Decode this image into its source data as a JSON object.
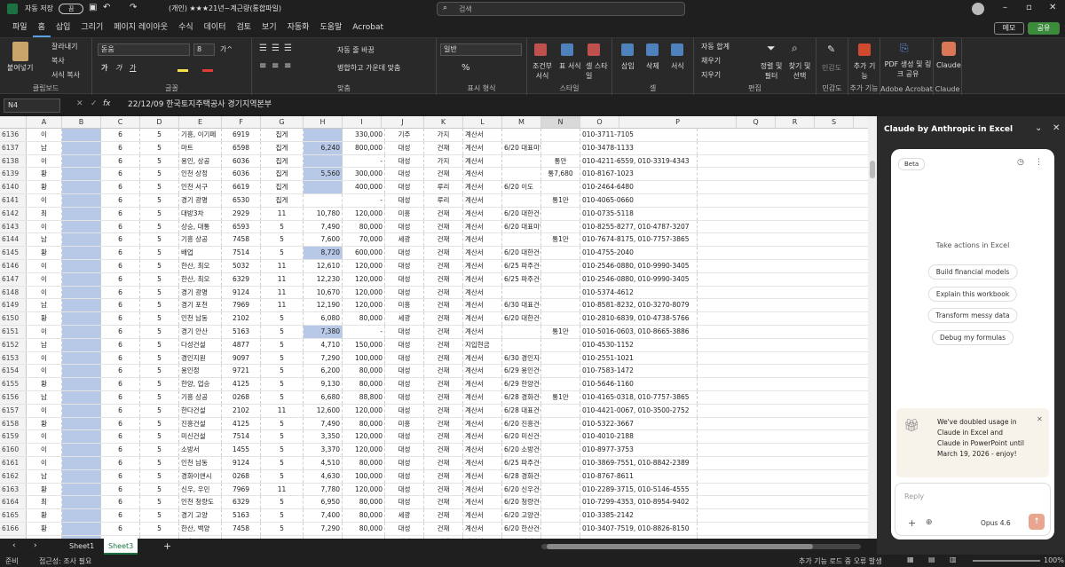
{
  "titlebar": {
    "autosave": "자동 저장",
    "autosave_state": "끔",
    "filename": "(개인) ★★★21년~계근량(통합파일)",
    "search_placeholder": "검색"
  },
  "tabs": [
    "파일",
    "홈",
    "삽입",
    "그리기",
    "페이지 레이아웃",
    "수식",
    "데이터",
    "검토",
    "보기",
    "자동화",
    "도움말",
    "Acrobat"
  ],
  "ribbon_right": {
    "memo": "메모",
    "share": "공유"
  },
  "ribbon": {
    "clipboard": {
      "label": "클립보드",
      "paste": "붙여넣기",
      "cut": "잘라내기",
      "copy": "복사",
      "format_painter": "서식 복사"
    },
    "font": {
      "label": "글꼴",
      "name": "돋움",
      "size": "8",
      "bold": "가",
      "italic": "가",
      "underline": "가",
      "grow": "가^",
      "shrink": "가v"
    },
    "align": {
      "label": "맞춤",
      "wrap": "자동 줄 바꿈",
      "merge": "병합하고 가운데 맞춤"
    },
    "number": {
      "label": "표시 형식",
      "format": "일반"
    },
    "styles": {
      "label": "스타일",
      "cond": "조건부 서식",
      "table": "표 서식",
      "cell": "셀 스타일"
    },
    "cells": {
      "label": "셀",
      "insert": "삽입",
      "delete": "삭제",
      "format": "서식"
    },
    "edit": {
      "label": "편집",
      "autosum": "자동 합계",
      "fill": "채우기",
      "clear": "지우기",
      "sort": "정렬 및 필터",
      "find": "찾기 및 선택"
    },
    "sens": {
      "label": "민감도",
      "btn": "민감도"
    },
    "addins": {
      "label": "추가 기능",
      "btn": "추가 기능"
    },
    "acrobat": {
      "label": "Adobe Acrobat",
      "btn": "PDF 생성 및 링크 공유"
    },
    "claude": {
      "label": "Claude",
      "btn": "Claude"
    }
  },
  "formula": {
    "namebox": "N4",
    "fx": "fx",
    "value": "22/12/09 한국토지주택공사 경기지역본부"
  },
  "columns": [
    "A",
    "B",
    "C",
    "D",
    "E",
    "F",
    "G",
    "H",
    "I",
    "J",
    "K",
    "L",
    "M",
    "N",
    "O",
    "P",
    "Q",
    "R",
    "S"
  ],
  "rows": [
    [
      "6136",
      "이",
      "",
      "6",
      "5",
      "기흥, 이기페",
      "6919",
      "집게",
      "",
      "330,000",
      "기주",
      "가지",
      "계산서",
      "",
      "",
      "010-3711-7105"
    ],
    [
      "6137",
      "남",
      "",
      "6",
      "5",
      "마트",
      "6598",
      "집게",
      "6,240",
      "800,000",
      "대성",
      "건재",
      "계산서",
      "6/20 대표미일",
      "",
      "010-3478-1133"
    ],
    [
      "6138",
      "이",
      "",
      "6",
      "5",
      "용인, 상공",
      "6036",
      "집게",
      "",
      "-",
      "대성",
      "가지",
      "계산서",
      "",
      "통안",
      "010-4211-6559, 010-3319-4343"
    ],
    [
      "6139",
      "황",
      "",
      "6",
      "5",
      "인천 상정",
      "6036",
      "집게",
      "5,560",
      "300,000",
      "대성",
      "건재",
      "계산서",
      "",
      "통7,680",
      "010-8167-1023"
    ],
    [
      "6140",
      "황",
      "",
      "6",
      "5",
      "인천 서구",
      "6619",
      "집게",
      "",
      "400,000",
      "대성",
      "루리",
      "계산서",
      "6/20 이도",
      "",
      "010-2464-6480"
    ],
    [
      "6141",
      "이",
      "",
      "6",
      "5",
      "경기 광명",
      "6530",
      "집게",
      "",
      "-",
      "대성",
      "루리",
      "계산서",
      "",
      "통1만",
      "010-4065-0660"
    ],
    [
      "6142",
      "최",
      "",
      "6",
      "5",
      "대방3차",
      "2929",
      "11",
      "10,780",
      "120,000",
      "미흥",
      "건재",
      "계산서",
      "6/20 대한건설",
      "",
      "010-0735-5118"
    ],
    [
      "6143",
      "이",
      "",
      "6",
      "5",
      "상승, 대통",
      "6593",
      "5",
      "7,490",
      "80,000",
      "대성",
      "건재",
      "계산서",
      "6/20 대표미일",
      "",
      "010-8255-8277, 010-4787-3207"
    ],
    [
      "6144",
      "남",
      "",
      "6",
      "5",
      "기흥 상공",
      "7458",
      "5",
      "7,600",
      "70,000",
      "세광",
      "건재",
      "계산서",
      "",
      "통1만",
      "010-7674-8175, 010-7757-3865"
    ],
    [
      "6145",
      "황",
      "",
      "6",
      "5",
      "배업",
      "7514",
      "5",
      "8,720",
      "600,000",
      "대성",
      "건재",
      "계산서",
      "6/20 대한건설",
      "",
      "010-4755-2040"
    ],
    [
      "6146",
      "이",
      "",
      "6",
      "5",
      "한산, 최오",
      "5032",
      "11",
      "12,610",
      "120,000",
      "대성",
      "건재",
      "계산서",
      "6/25 파주건설",
      "",
      "010-2546-0880, 010-9990-3405"
    ],
    [
      "6147",
      "이",
      "",
      "6",
      "5",
      "한산, 최오",
      "6329",
      "11",
      "12,230",
      "120,000",
      "대성",
      "건재",
      "계산서",
      "6/25 파주건설",
      "",
      "010-2546-0880, 010-9990-3405"
    ],
    [
      "6148",
      "이",
      "",
      "6",
      "5",
      "경기 광명",
      "9124",
      "11",
      "10,670",
      "120,000",
      "대성",
      "건재",
      "계산서",
      "",
      "",
      "010-5374-4612"
    ],
    [
      "6149",
      "남",
      "",
      "6",
      "5",
      "경기 포천",
      "7969",
      "11",
      "12,190",
      "120,000",
      "미흥",
      "건재",
      "계산서",
      "6/30 대표건설",
      "",
      "010-8581-8232, 010-3270-8079"
    ],
    [
      "6150",
      "황",
      "",
      "6",
      "5",
      "인천 남동",
      "2102",
      "5",
      "6,080",
      "80,000",
      "세광",
      "건재",
      "계산서",
      "6/20 대한건설",
      "",
      "010-2810-6839, 010-4738-5766"
    ],
    [
      "6151",
      "이",
      "",
      "6",
      "5",
      "경기 안산",
      "5163",
      "5",
      "7,380",
      "-",
      "대성",
      "건재",
      "계산서",
      "",
      "통1만",
      "010-5016-0603, 010-8665-3886"
    ],
    [
      "6152",
      "남",
      "",
      "6",
      "5",
      "다성건설",
      "4877",
      "5",
      "4,710",
      "150,000",
      "대성",
      "건재",
      "지입현금",
      "",
      "",
      "010-4530-1152"
    ],
    [
      "6153",
      "이",
      "",
      "6",
      "5",
      "경인지원",
      "9097",
      "5",
      "7,290",
      "100,000",
      "대성",
      "건재",
      "계산서",
      "6/30 경인지원",
      "",
      "010-2551-1021"
    ],
    [
      "6154",
      "이",
      "",
      "6",
      "5",
      "용인정",
      "9721",
      "5",
      "6,200",
      "80,000",
      "대성",
      "건재",
      "계산서",
      "6/29 용인건설",
      "",
      "010-7583-1472"
    ],
    [
      "6155",
      "황",
      "",
      "6",
      "5",
      "한양, 업승",
      "4125",
      "5",
      "9,130",
      "80,000",
      "대성",
      "건재",
      "계산서",
      "6/29 한양건설",
      "",
      "010-5646-1160"
    ],
    [
      "6156",
      "남",
      "",
      "6",
      "5",
      "기흥 상공",
      "0268",
      "5",
      "6,680",
      "88,800",
      "대성",
      "건재",
      "계산서",
      "6/28 경화건설",
      "통1만",
      "010-4165-0318, 010-7757-3865"
    ],
    [
      "6157",
      "이",
      "",
      "6",
      "5",
      "한다건설",
      "2102",
      "11",
      "12,600",
      "120,000",
      "대성",
      "건재",
      "계산서",
      "6/28 대표건설",
      "",
      "010-4421-0067, 010-3500-2752"
    ],
    [
      "6158",
      "황",
      "",
      "6",
      "5",
      "진흥건설",
      "4125",
      "5",
      "7,490",
      "80,000",
      "미흥",
      "건재",
      "계산서",
      "6/20 진흥건설",
      "",
      "010-5322-3667"
    ],
    [
      "6159",
      "이",
      "",
      "6",
      "5",
      "미신건설",
      "7514",
      "5",
      "3,350",
      "120,000",
      "대성",
      "건재",
      "계산서",
      "6/20 미신건설",
      "",
      "010-4010-2188"
    ],
    [
      "6160",
      "이",
      "",
      "6",
      "5",
      "소방서",
      "1455",
      "5",
      "3,370",
      "120,000",
      "대성",
      "건재",
      "계산서",
      "6/20 소방건설",
      "",
      "010-8977-3753"
    ],
    [
      "6161",
      "이",
      "",
      "6",
      "5",
      "인천 남동",
      "9124",
      "5",
      "4,510",
      "80,000",
      "대성",
      "건재",
      "계산서",
      "6/25 파주건설",
      "",
      "010-3869-7551, 010-8842-2389"
    ],
    [
      "6162",
      "남",
      "",
      "6",
      "5",
      "경화이앤시",
      "0268",
      "5",
      "4,630",
      "100,000",
      "대성",
      "건재",
      "계산서",
      "6/28 경화건설",
      "",
      "010-8767-8611"
    ],
    [
      "6163",
      "황",
      "",
      "6",
      "5",
      "신우, 우민",
      "7969",
      "11",
      "7,780",
      "120,000",
      "대성",
      "건재",
      "계산서",
      "6/20 신우건설",
      "",
      "010-2289-3715, 010-5146-4555"
    ],
    [
      "6164",
      "최",
      "",
      "6",
      "5",
      "인천 청량도",
      "6329",
      "5",
      "6,950",
      "80,000",
      "대성",
      "건재",
      "계산서",
      "6/20 청량건설",
      "",
      "010-7299-4353, 010-8954-9402"
    ],
    [
      "6165",
      "황",
      "",
      "6",
      "5",
      "경기 고양",
      "5163",
      "5",
      "7,400",
      "80,000",
      "세광",
      "건재",
      "계산서",
      "6/20 고양건설",
      "",
      "010-3385-2142"
    ],
    [
      "6166",
      "황",
      "",
      "6",
      "5",
      "한산, 백양",
      "7458",
      "5",
      "7,290",
      "80,000",
      "대성",
      "건재",
      "계산서",
      "6/20 한산건설",
      "",
      "010-3407-7519, 010-8826-8150"
    ],
    [
      "6167",
      "이",
      "",
      "6",
      "5",
      "시흥 지오",
      "4877",
      "5",
      "7,240",
      "20,000",
      "대성",
      "건재",
      "계산서",
      "6/25 삼성건설",
      "",
      "010-2067-6592"
    ],
    [
      "6168",
      "황",
      "",
      "6",
      "5",
      "한다건설",
      "4351",
      "5",
      "7,410",
      "80,000",
      "대성",
      "건재",
      "계산서",
      "6/20 한다건설",
      "",
      "010-7121-0777, 010-9348-6701"
    ]
  ],
  "sheets": [
    "Sheet1",
    "Sheet3"
  ],
  "status": {
    "ready": "준비",
    "access": "접근성: 조사 필요",
    "addins": "추가 기능 로드 중 오류 발생",
    "zoom": "100%"
  },
  "panel": {
    "title": "Claude by Anthropic in Excel",
    "beta": "Beta",
    "prompt": "Take actions in Excel",
    "suggestions": [
      "Build financial models",
      "Explain this workbook",
      "Transform messy data",
      "Debug my formulas"
    ],
    "promo": "We've doubled usage in Claude in Excel and Claude in PowerPoint until March 19, 2026 - enjoy!",
    "reply_placeholder": "Reply",
    "model": "Opus 4.6"
  }
}
